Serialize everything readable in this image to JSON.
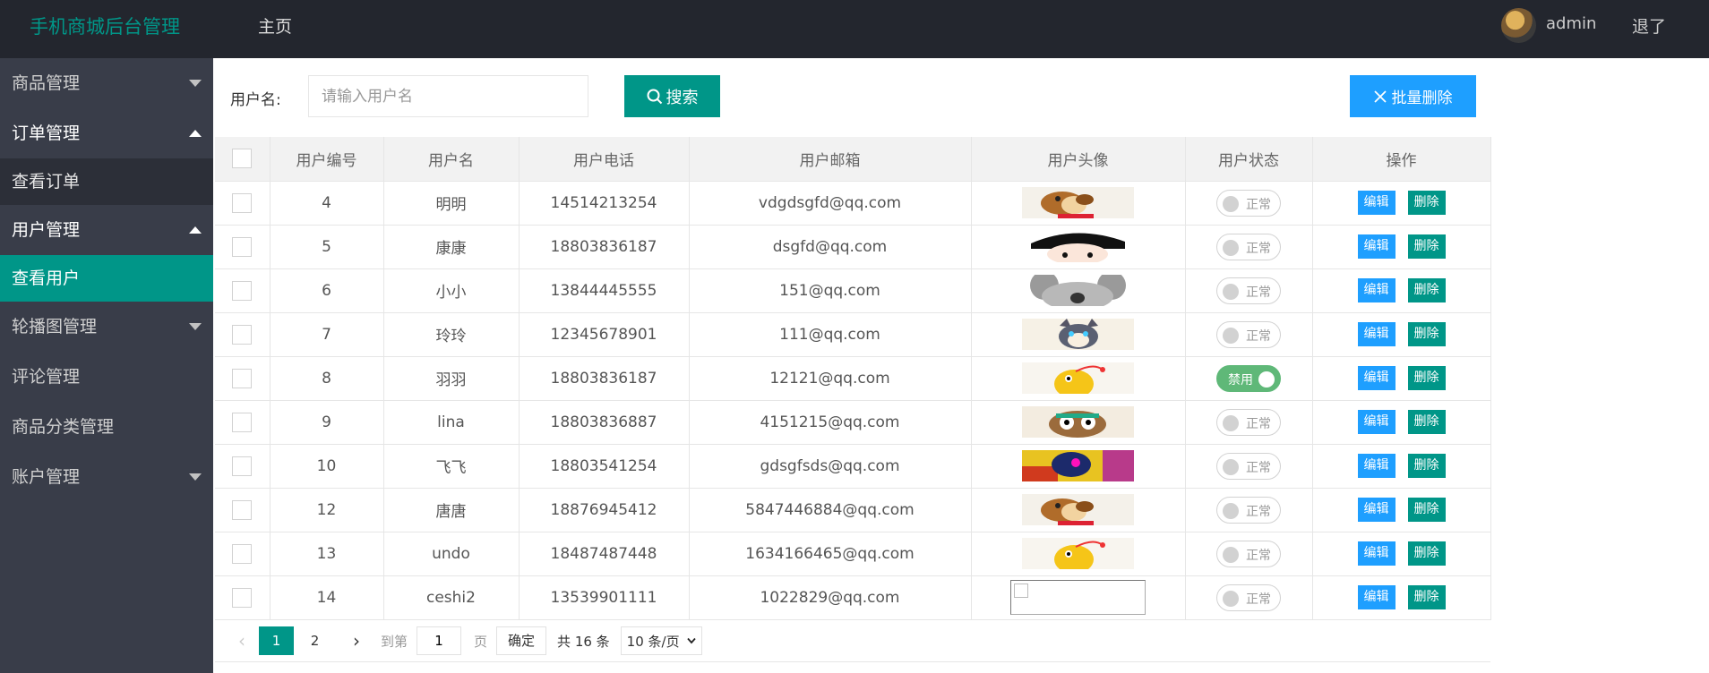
{
  "header": {
    "title": "手机商城后台管理",
    "nav_home": "主页",
    "user_name": "admin",
    "logout": "退了"
  },
  "sidebar": {
    "items": [
      {
        "label": "商品管理"
      },
      {
        "label": "订单管理"
      },
      {
        "label": "查看订单"
      },
      {
        "label": "用户管理"
      },
      {
        "label": "查看用户"
      },
      {
        "label": "轮播图管理"
      },
      {
        "label": "评论管理"
      },
      {
        "label": "商品分类管理"
      },
      {
        "label": "账户管理"
      }
    ]
  },
  "search": {
    "label": "用户名:",
    "placeholder": "请输入用户名",
    "search_button": "搜索",
    "batch_delete_button": "批量删除"
  },
  "table": {
    "columns": [
      "用户编号",
      "用户名",
      "用户电话",
      "用户邮箱",
      "用户头像",
      "用户状态",
      "操作"
    ],
    "edit_label": "编辑",
    "delete_label": "删除",
    "rows": [
      {
        "id": "4",
        "name": "明明",
        "phone": "14514213254",
        "email": "vdgdsgfd@qq.com",
        "avatar_icon": "dog-avatar",
        "status": "正常"
      },
      {
        "id": "5",
        "name": "康康",
        "phone": "18803836187",
        "email": "dsgfd@qq.com",
        "avatar_icon": "boy-avatar",
        "status": "正常"
      },
      {
        "id": "6",
        "name": "小小",
        "phone": "13844445555",
        "email": "151@qq.com",
        "avatar_icon": "koala-avatar",
        "status": "正常"
      },
      {
        "id": "7",
        "name": "玲玲",
        "phone": "12345678901",
        "email": "111@qq.com",
        "avatar_icon": "cat-avatar",
        "status": "正常"
      },
      {
        "id": "8",
        "name": "羽羽",
        "phone": "18803836187",
        "email": "12121@qq.com",
        "avatar_icon": "larva-avatar",
        "status": "禁用"
      },
      {
        "id": "9",
        "name": "lina",
        "phone": "18803836887",
        "email": "4151215@qq.com",
        "avatar_icon": "owl-avatar",
        "status": "正常"
      },
      {
        "id": "10",
        "name": "飞飞",
        "phone": "18803541254",
        "email": "gdsgfsds@qq.com",
        "avatar_icon": "art-avatar",
        "status": "正常"
      },
      {
        "id": "12",
        "name": "唐唐",
        "phone": "18876945412",
        "email": "5847446884@qq.com",
        "avatar_icon": "dog-avatar",
        "status": "正常"
      },
      {
        "id": "13",
        "name": "undo",
        "phone": "18487487448",
        "email": "1634166465@qq.com",
        "avatar_icon": "larva-avatar",
        "status": "正常"
      },
      {
        "id": "14",
        "name": "ceshi2",
        "phone": "13539901111",
        "email": "1022829@qq.com",
        "avatar_icon": "broken-image",
        "status": "正常"
      }
    ]
  },
  "pagination": {
    "pages": [
      "1",
      "2"
    ],
    "current": "1",
    "goto_label": "到第",
    "goto_value": "1",
    "page_unit": "页",
    "confirm": "确定",
    "total": "共 16 条",
    "page_size": "10 条/页"
  },
  "colors": {
    "header_bg": "#23262e",
    "sidebar_bg": "#393d49",
    "primary": "#009688",
    "blue": "#1e9fff",
    "switch_on": "#5fb878"
  }
}
